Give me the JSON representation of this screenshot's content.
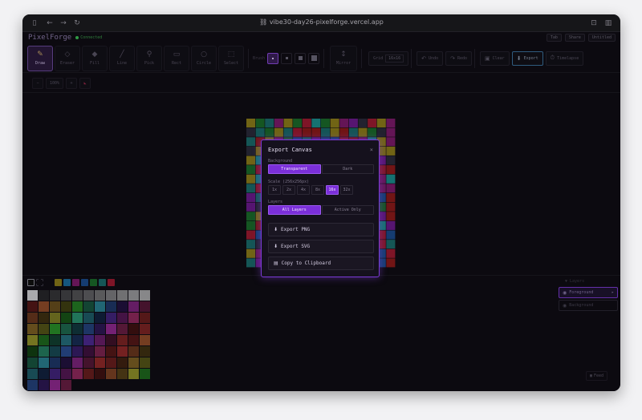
{
  "browser": {
    "url": "vibe30-day26-pixelforge.vercel.app",
    "icons": [
      "sidebar-icon",
      "back-icon",
      "forward-icon",
      "reload-icon",
      "link-icon",
      "extension-icon",
      "tabs-icon"
    ]
  },
  "header": {
    "logo": "PixelForge",
    "status": "Connected",
    "right_buttons": [
      "Tab",
      "Share",
      "Untitled"
    ]
  },
  "tools": [
    {
      "label": "Draw",
      "icon": "✎",
      "active": true
    },
    {
      "label": "Eraser",
      "icon": "◇",
      "active": false
    },
    {
      "label": "Fill",
      "icon": "◆",
      "active": false
    },
    {
      "label": "Line",
      "icon": "╱",
      "active": false
    },
    {
      "label": "Pick",
      "icon": "⚲",
      "active": false
    },
    {
      "label": "Rect",
      "icon": "▭",
      "active": false
    },
    {
      "label": "Circle",
      "icon": "○",
      "active": false
    },
    {
      "label": "Select",
      "icon": "⬚",
      "active": false
    }
  ],
  "brush": {
    "label": "Brush",
    "selected": 0
  },
  "toolbar_buttons": {
    "mirror": "Mirror",
    "grid_label": "Grid",
    "grid_size": "16x16",
    "undo": "Undo",
    "redo": "Redo",
    "clear": "Clear",
    "export": "Export",
    "timelapse": "Timelapse"
  },
  "zoom": {
    "minus": "−",
    "value": "100%",
    "plus": "+"
  },
  "layers": {
    "title": "Layers",
    "items": [
      {
        "name": "Foreground",
        "active": true,
        "more": "▸"
      },
      {
        "name": "Background",
        "active": false
      }
    ]
  },
  "feed_button": "Feed",
  "modal": {
    "title": "Export Canvas",
    "close": "×",
    "background_label": "Background",
    "background_options": [
      "Transparent",
      "Dark"
    ],
    "background_selected": 0,
    "scale_label": "Scale (256x256px)",
    "scale_options": [
      "1x",
      "2x",
      "4x",
      "8x",
      "16x",
      "32x"
    ],
    "scale_selected": 4,
    "layers_label": "Layers",
    "layers_options": [
      "All Layers",
      "Active Only"
    ],
    "layers_selected": 0,
    "actions": [
      {
        "icon": "⬇",
        "label": "Export PNG"
      },
      {
        "icon": "⬇",
        "label": "Export SVG"
      },
      {
        "icon": "▤",
        "label": "Copy to Clipboard"
      }
    ]
  },
  "colors": {
    "accent": "#7b2fd9",
    "canvas_palette": [
      "#9a1a30",
      "#1a6a6a",
      "#7a1a6a",
      "#1a4a8a",
      "#8a7a1a",
      "#1a6a2a",
      "#2a2a3a",
      "#6a1a8a",
      "#1a8a8a",
      "#8a1a1a"
    ],
    "recent_swatches": [
      "#8a7a1a",
      "#1a6a9a",
      "#7a1a6a",
      "#1a4a8a",
      "#1a6a2a",
      "#1a6a6a",
      "#9a1a30"
    ]
  }
}
